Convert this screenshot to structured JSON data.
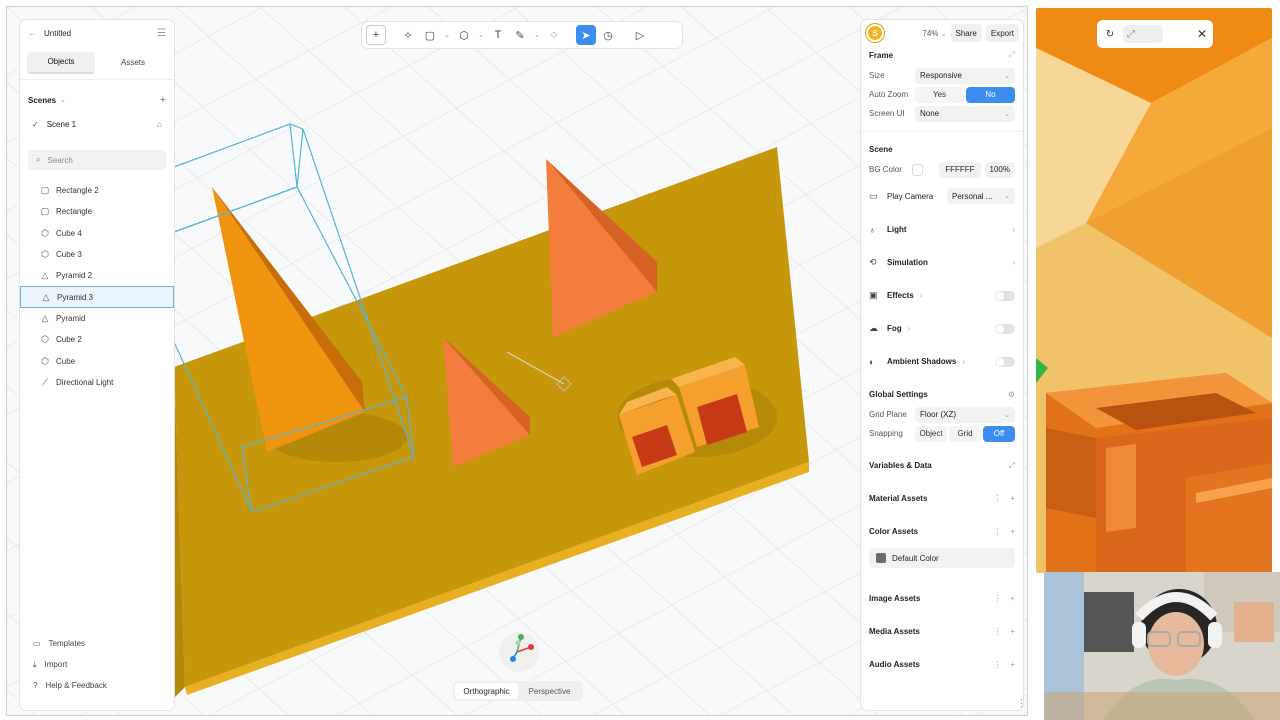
{
  "project": {
    "title": "Untitled"
  },
  "left_panel": {
    "tabs": [
      {
        "label": "Objects"
      },
      {
        "label": "Assets"
      }
    ],
    "scenes_label": "Scenes",
    "scene_item": "Scene 1",
    "search_placeholder": "Search",
    "objects": [
      {
        "label": "Rectangle 2",
        "icon": "square-icon"
      },
      {
        "label": "Rectangle",
        "icon": "square-icon"
      },
      {
        "label": "Cube 4",
        "icon": "cube-icon"
      },
      {
        "label": "Cube 3",
        "icon": "cube-icon"
      },
      {
        "label": "Pyramid 2",
        "icon": "pyramid-icon"
      },
      {
        "label": "Pyramid 3",
        "icon": "pyramid-icon"
      },
      {
        "label": "Pyramid",
        "icon": "pyramid-icon"
      },
      {
        "label": "Cube 2",
        "icon": "cube-icon"
      },
      {
        "label": "Cube",
        "icon": "cube-icon"
      },
      {
        "label": "Directional Light",
        "icon": "light-icon"
      }
    ],
    "selected_object": "Pyramid 3",
    "bottom": [
      {
        "label": "Templates"
      },
      {
        "label": "Import"
      },
      {
        "label": "Help & Feedback"
      }
    ]
  },
  "view_toggle": {
    "options": [
      "Orthographic",
      "Perspective"
    ],
    "active": "Orthographic"
  },
  "right_panel": {
    "avatar_letter": "S",
    "zoom": "74%",
    "share": "Share",
    "export": "Export",
    "frame": {
      "title": "Frame",
      "size_label": "Size",
      "size_value": "Responsive",
      "autozoom_label": "Auto Zoom",
      "autozoom_yes": "Yes",
      "autozoom_no": "No",
      "screenui_label": "Screen UI",
      "screenui_value": "None"
    },
    "scene": {
      "title": "Scene",
      "bg_label": "BG Color",
      "bg_hex": "FFFFFF",
      "bg_opacity": "100%",
      "play_camera_label": "Play Camera",
      "play_camera_value": "Personal ..."
    },
    "items": {
      "light": "Light",
      "simulation": "Simulation",
      "effects": "Effects",
      "fog": "Fog",
      "ambient": "Ambient Shadows"
    },
    "global": {
      "title": "Global Settings",
      "grid_label": "Grid Plane",
      "grid_value": "Floor (XZ)",
      "snap_label": "Snapping",
      "snap_object": "Object",
      "snap_grid": "Grid",
      "snap_off": "Off"
    },
    "assets": {
      "variables": "Variables & Data",
      "material": "Material Assets",
      "color": "Color Assets",
      "default_color": "Default Color",
      "image": "Image Assets",
      "media": "Media Assets",
      "audio": "Audio Assets"
    }
  },
  "colors": {
    "accent": "#3b8ef0",
    "board": "#c9980a",
    "pyramid": "#f08a2c",
    "cube": "#f59e2d"
  }
}
